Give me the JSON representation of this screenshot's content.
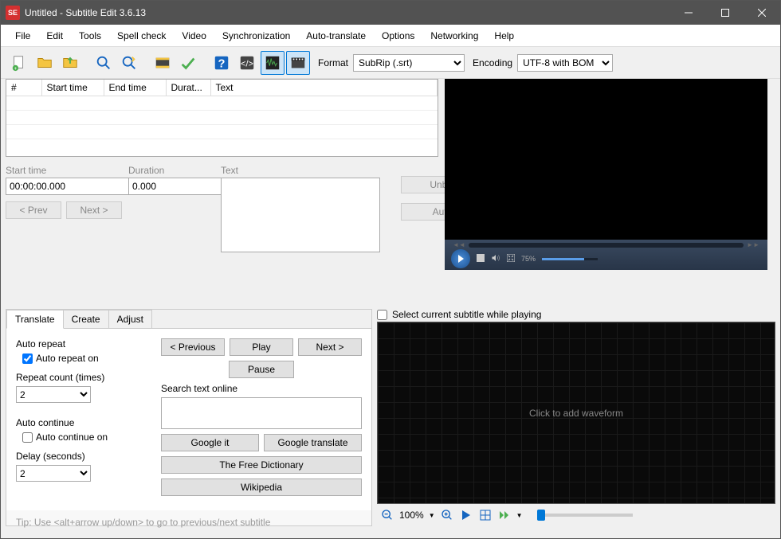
{
  "title": "Untitled - Subtitle Edit 3.6.13",
  "menu": [
    "File",
    "Edit",
    "Tools",
    "Spell check",
    "Video",
    "Synchronization",
    "Auto-translate",
    "Options",
    "Networking",
    "Help"
  ],
  "toolbar": {
    "format_label": "Format",
    "format_value": "SubRip (.srt)",
    "encoding_label": "Encoding",
    "encoding_value": "UTF-8 with BOM"
  },
  "grid": {
    "cols": [
      "#",
      "Start time",
      "End time",
      "Durat...",
      "Text"
    ]
  },
  "edit": {
    "start_label": "Start time",
    "start_value": "00:00:00.000",
    "duration_label": "Duration",
    "duration_value": "0.000",
    "text_label": "Text",
    "prev": "< Prev",
    "next": "Next >",
    "unbreak": "Unbreak",
    "autobr": "Auto br"
  },
  "player": {
    "volume_pct": "75%"
  },
  "tabs": {
    "t0": "Translate",
    "t1": "Create",
    "t2": "Adjust"
  },
  "translate": {
    "autorepeat_title": "Auto repeat",
    "autorepeat_on": "Auto repeat on",
    "repeat_count_label": "Repeat count (times)",
    "repeat_count_value": "2",
    "autocontinue_title": "Auto continue",
    "autocontinue_on": "Auto continue on",
    "delay_label": "Delay (seconds)",
    "delay_value": "2",
    "previous": "< Previous",
    "play": "Play",
    "next": "Next >",
    "pause": "Pause",
    "search_label": "Search text online",
    "google_it": "Google it",
    "google_translate": "Google translate",
    "free_dict": "The Free Dictionary",
    "wikipedia": "Wikipedia"
  },
  "tip": "Tip: Use <alt+arrow up/down> to go to previous/next subtitle",
  "selcheck": "Select current subtitle while playing",
  "waveform_hint": "Click to add waveform",
  "zoom": "100%"
}
